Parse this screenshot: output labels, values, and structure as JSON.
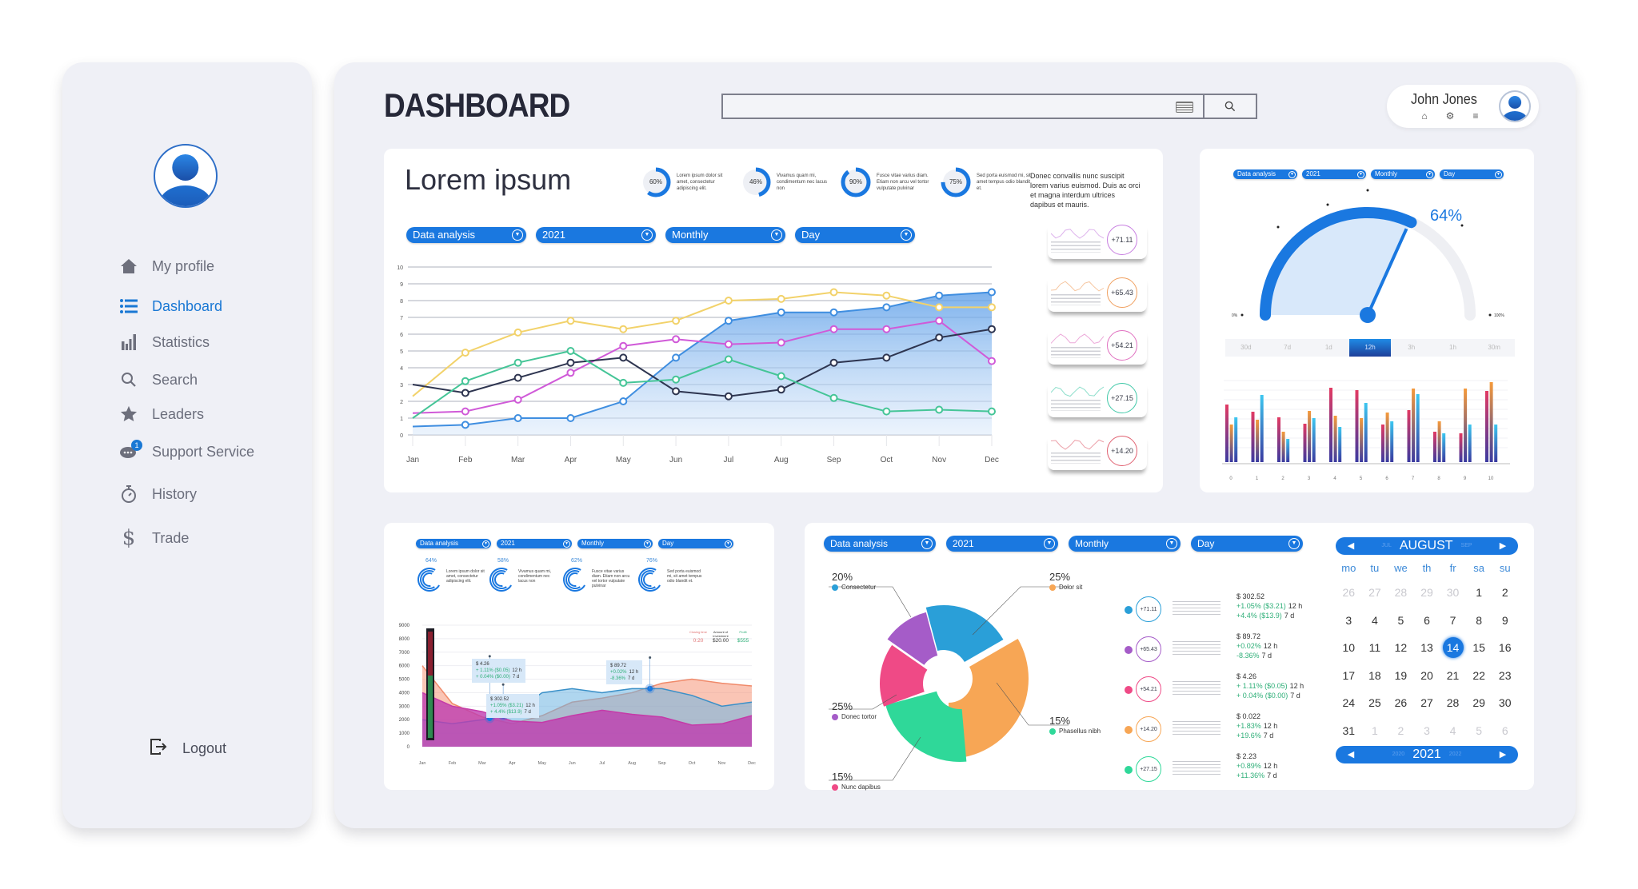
{
  "sidebar": {
    "items": [
      {
        "label": "My profile",
        "icon": "home-icon",
        "active": false
      },
      {
        "label": "Dashboard",
        "icon": "list-icon",
        "active": true
      },
      {
        "label": "Statistics",
        "icon": "bar-chart-icon",
        "active": false
      },
      {
        "label": "Search",
        "icon": "search-icon",
        "active": false
      },
      {
        "label": "Leaders",
        "icon": "star-icon",
        "active": false
      },
      {
        "label": "Support Service",
        "icon": "chat-icon",
        "active": false,
        "badge": "1"
      },
      {
        "label": "History",
        "icon": "stopwatch-icon",
        "active": false
      },
      {
        "label": "Trade",
        "icon": "dollar-icon",
        "active": false
      }
    ],
    "logout_label": "Logout"
  },
  "header": {
    "title": "DASHBOARD",
    "search": {
      "value": "",
      "placeholder": ""
    },
    "user": {
      "name": "John Jones"
    }
  },
  "filters": {
    "data_analysis": "Data analysis",
    "year": "2021",
    "period": "Monthly",
    "granularity": "Day"
  },
  "overview": {
    "title": "Lorem ipsum",
    "rings": [
      {
        "value": 60,
        "label": "60%",
        "text": "Lorem ipsum dolor sit amet, consectetur adipiscing elit."
      },
      {
        "value": 46,
        "label": "46%",
        "text": "Vivamus quam mi, condimentum nec lacus non"
      },
      {
        "value": 90,
        "label": "90%",
        "text": "Fusce vitae varius diam. Etiam non arcu vel tortor vulputate pulvinar"
      },
      {
        "value": 75,
        "label": "75%",
        "text": "Sed porta euismod mi, sit amet tempus odio blandit et."
      }
    ],
    "side_text": "Donec convallis nunc suscipit lorem varius euismod. Duis ac orci et magna interdum ultrices dapibus et mauris.",
    "mini_cards": [
      {
        "value": "+71.11",
        "color": "#c77ee0"
      },
      {
        "value": "+65.43",
        "color": "#f0a060"
      },
      {
        "value": "+54.21",
        "color": "#e070c0"
      },
      {
        "value": "+27.15",
        "color": "#40c8a8"
      },
      {
        "value": "+14.20",
        "color": "#e06070"
      }
    ]
  },
  "gauge": {
    "value_label": "64%",
    "min_label": "0%",
    "max_label": "100%",
    "ranges": [
      "30d",
      "7d",
      "1d",
      "12h",
      "3h",
      "1h",
      "30m"
    ],
    "selected_range": "12h"
  },
  "bottom_left": {
    "rings": [
      {
        "label": "64%",
        "text": "Lorem ipsum dolor sit amet, consectetur adipiscing elit."
      },
      {
        "label": "58%",
        "text": "Vivamus quam mi, condimentum nec lacus non"
      },
      {
        "label": "62%",
        "text": "Fusce vitae varius diam. Etiam non arcu vel tortor vulputate pulvinar"
      },
      {
        "label": "76%",
        "text": "Sed porta euismod mi, sit amet tempus odio blandit et."
      }
    ],
    "legend": [
      {
        "title": "Closing time",
        "value": "0:20",
        "color": "#e07070"
      },
      {
        "title": "Amount of investment",
        "value": "$20.00",
        "color": "#333333"
      },
      {
        "title": "Profit",
        "value": "$555",
        "color": "#2eaf78"
      }
    ],
    "tooltips": [
      {
        "price": "$ 4.26",
        "l1": "+ 1.11% ($0.05)",
        "l1s": "12 h",
        "l2": "+ 0.04% ($0.00)",
        "l2s": "7 d"
      },
      {
        "price": "$ 302.52",
        "l1": "+1.05% ($3.21)",
        "l1s": "12 h",
        "l2": "+ 4.4% ($13.9)",
        "l2s": "7 d"
      },
      {
        "price": "$ 89.72",
        "l1": "+0.02%",
        "l1s": "12 h",
        "l2": "-8.36%",
        "l2s": "7 d"
      }
    ]
  },
  "donut_panel": {
    "slices": [
      {
        "pct": "20%",
        "label": "Consectetur",
        "color": "#2a9fd8"
      },
      {
        "pct": "25%",
        "label": "Dolor sit",
        "color": "#f7a655"
      },
      {
        "pct": "15%",
        "label": "Phasellus nibh",
        "color": "#2fd899"
      },
      {
        "pct": "15%",
        "label": "Nunc dapibus",
        "color": "#ef4a86"
      },
      {
        "pct": "25%",
        "label": "Donec tortor",
        "color": "#a55cc8"
      }
    ],
    "stats": [
      {
        "color": "#2a9fd8",
        "badge": "+71.11",
        "price": "$ 302.52",
        "l1": "+1.05% ($3.21)",
        "l1s": "12 h",
        "l2": "+4.4% ($13.9)",
        "l2s": "7 d"
      },
      {
        "color": "#a55cc8",
        "badge": "+65.43",
        "price": "$ 89.72",
        "l1": "+0.02%",
        "l1s": "12 h",
        "l2": "-8.36%",
        "l2s": "7 d"
      },
      {
        "color": "#ef4a86",
        "badge": "+54.21",
        "price": "$ 4.26",
        "l1": "+ 1.11% ($0.05)",
        "l1s": "12 h",
        "l2": "+ 0.04% ($0.00)",
        "l2s": "7 d"
      },
      {
        "color": "#f7a655",
        "badge": "+14.20",
        "price": "$ 0.022",
        "l1": "+1.83%",
        "l1s": "12 h",
        "l2": "+19.6%",
        "l2s": "7 d"
      },
      {
        "color": "#2fd899",
        "badge": "+27.15",
        "price": "$ 2.23",
        "l1": "+0.89%",
        "l1s": "12 h",
        "l2": "+11.36%",
        "l2s": "7 d"
      }
    ]
  },
  "calendar": {
    "month": "AUGUST",
    "prev_month": "JUL",
    "next_month": "SEP",
    "year": "2021",
    "prev_year": "2020",
    "next_year": "2022",
    "weekdays": [
      "mo",
      "tu",
      "we",
      "th",
      "fr",
      "sa",
      "su"
    ],
    "days": [
      {
        "d": "26",
        "m": true
      },
      {
        "d": "27",
        "m": true
      },
      {
        "d": "28",
        "m": true
      },
      {
        "d": "29",
        "m": true
      },
      {
        "d": "30",
        "m": true
      },
      {
        "d": "1"
      },
      {
        "d": "2"
      },
      {
        "d": "3"
      },
      {
        "d": "4"
      },
      {
        "d": "5"
      },
      {
        "d": "6"
      },
      {
        "d": "7"
      },
      {
        "d": "8"
      },
      {
        "d": "9"
      },
      {
        "d": "10"
      },
      {
        "d": "11"
      },
      {
        "d": "12"
      },
      {
        "d": "13"
      },
      {
        "d": "14",
        "sel": true
      },
      {
        "d": "15"
      },
      {
        "d": "16"
      },
      {
        "d": "17"
      },
      {
        "d": "18"
      },
      {
        "d": "19"
      },
      {
        "d": "20"
      },
      {
        "d": "21"
      },
      {
        "d": "22"
      },
      {
        "d": "23"
      },
      {
        "d": "24"
      },
      {
        "d": "25"
      },
      {
        "d": "26"
      },
      {
        "d": "27"
      },
      {
        "d": "28"
      },
      {
        "d": "29"
      },
      {
        "d": "30"
      },
      {
        "d": "31"
      },
      {
        "d": "1",
        "m": true
      },
      {
        "d": "2",
        "m": true
      },
      {
        "d": "3",
        "m": true
      },
      {
        "d": "4",
        "m": true
      },
      {
        "d": "5",
        "m": true
      },
      {
        "d": "6",
        "m": true
      }
    ]
  },
  "chart_data": [
    {
      "type": "line",
      "title": "",
      "categories": [
        "Jan",
        "Feb",
        "Mar",
        "Apr",
        "May",
        "Jun",
        "Jul",
        "Aug",
        "Sep",
        "Oct",
        "Nov",
        "Dec"
      ],
      "ylim": [
        0,
        10
      ],
      "yticks": [
        0,
        1,
        2,
        3,
        4,
        5,
        6,
        7,
        8,
        9,
        10
      ],
      "grid": true,
      "series": [
        {
          "name": "blue",
          "color": "#3f8ee0",
          "area": true,
          "values": [
            0.5,
            0.6,
            1.0,
            1.0,
            2.0,
            4.6,
            6.8,
            7.3,
            7.3,
            7.6,
            8.3,
            8.5
          ]
        },
        {
          "name": "yellow",
          "color": "#f2d26a",
          "values": [
            2.3,
            4.9,
            6.1,
            6.8,
            6.3,
            6.8,
            8.0,
            8.1,
            8.5,
            8.3,
            7.6,
            7.6
          ]
        },
        {
          "name": "magenta",
          "color": "#d05ad8",
          "values": [
            1.3,
            1.4,
            2.1,
            3.7,
            5.3,
            5.7,
            5.4,
            5.5,
            6.3,
            6.3,
            6.8,
            4.4
          ]
        },
        {
          "name": "dark",
          "color": "#2e3550",
          "values": [
            3.0,
            2.5,
            3.4,
            4.3,
            4.6,
            2.6,
            2.3,
            2.7,
            4.3,
            4.6,
            5.8,
            6.3
          ]
        },
        {
          "name": "green",
          "color": "#45c597",
          "values": [
            1.0,
            3.2,
            4.3,
            5.0,
            3.1,
            3.3,
            4.5,
            3.5,
            2.2,
            1.4,
            1.5,
            1.4
          ]
        }
      ]
    },
    {
      "type": "bar",
      "categories": [
        "0",
        "1",
        "2",
        "3",
        "4",
        "5",
        "6",
        "7",
        "8",
        "9",
        "10"
      ],
      "series": [
        {
          "name": "red",
          "color": "#e23a63",
          "values": [
            7.2,
            6.3,
            5.6,
            4.8,
            9.3,
            9.0,
            4.7,
            6.5,
            3.8,
            3.6,
            8.9
          ]
        },
        {
          "name": "orange",
          "color": "#f59a3a",
          "values": [
            4.7,
            5.3,
            3.8,
            6.4,
            5.8,
            5.5,
            6.2,
            9.2,
            5.1,
            9.2,
            10.0
          ]
        },
        {
          "name": "cyan",
          "color": "#3dc7f0",
          "values": [
            5.6,
            8.4,
            2.9,
            5.5,
            4.4,
            7.4,
            5.1,
            8.5,
            3.6,
            4.7,
            4.7
          ]
        }
      ]
    },
    {
      "type": "gauge",
      "value": 64,
      "range": [
        0,
        100
      ]
    },
    {
      "type": "area",
      "categories": [
        "Jan",
        "Feb",
        "Mar",
        "Apr",
        "May",
        "Jun",
        "Jul",
        "Aug",
        "Sep",
        "Oct",
        "Nov",
        "Dec"
      ],
      "ylim": [
        0,
        9000
      ],
      "yticks": [
        0,
        1000,
        2000,
        3000,
        4000,
        5000,
        6000,
        7000,
        8000,
        9000
      ],
      "series": [
        {
          "name": "orange",
          "color": "#f08a6a",
          "values": [
            6000,
            3200,
            2200,
            1700,
            2300,
            3300,
            3600,
            4000,
            4700,
            5000,
            4700,
            4500
          ]
        },
        {
          "name": "blue",
          "color": "#3a90c8",
          "values": [
            2000,
            1700,
            2000,
            2400,
            4000,
            4300,
            4000,
            4300,
            4300,
            3800,
            3000,
            3300
          ]
        },
        {
          "name": "magenta",
          "color": "#c53aa8",
          "values": [
            4000,
            3000,
            2600,
            1900,
            1800,
            2300,
            2700,
            2400,
            2200,
            1600,
            1700,
            2300
          ]
        }
      ]
    },
    {
      "type": "pie",
      "labels": [
        "Consectetur",
        "Dolor sit",
        "Phasellus nibh",
        "Nunc dapibus",
        "Donec tortor"
      ],
      "values": [
        20,
        25,
        15,
        15,
        25
      ]
    }
  ]
}
